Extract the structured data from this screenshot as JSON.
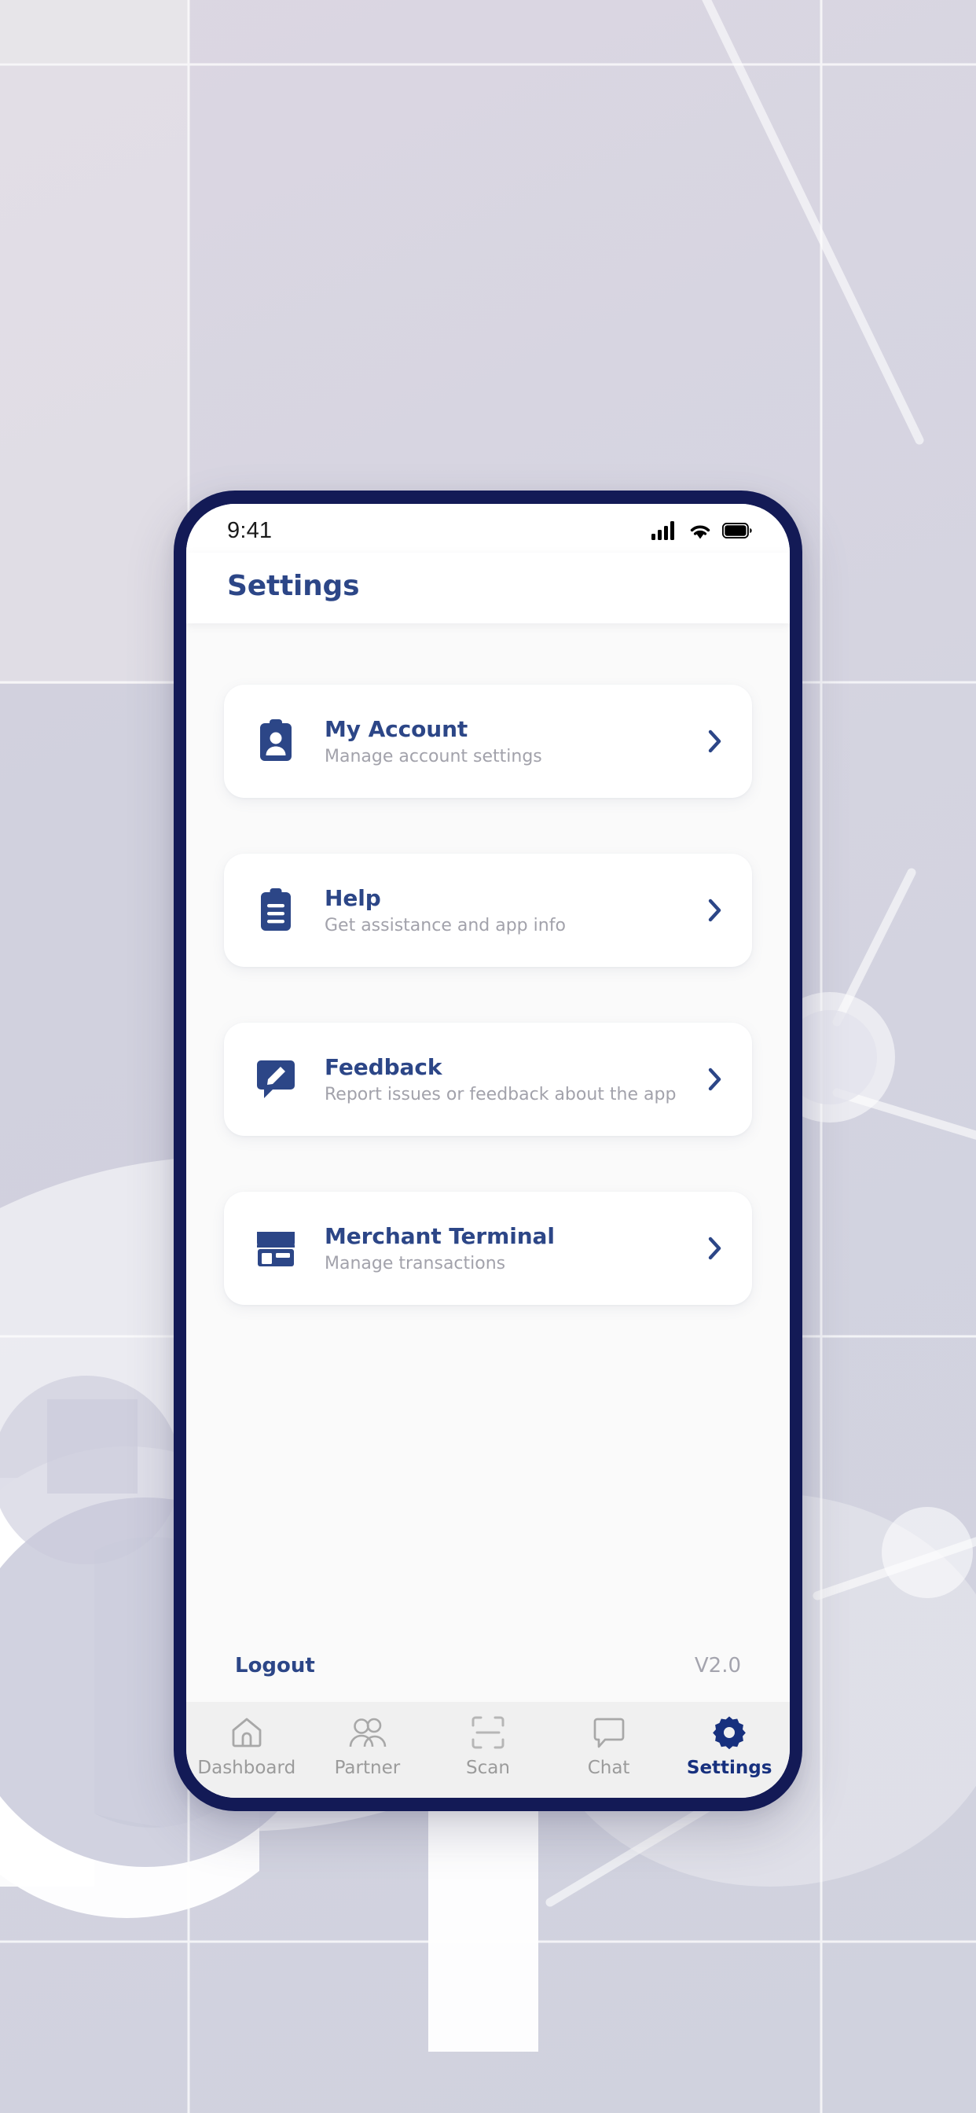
{
  "background": {
    "description": "abstract light lavender grid with network nodes and large white C monogram",
    "base_color": "#d6d4e0",
    "grid_line_color": "#ffffff",
    "accent_shape_color": "#ffffff"
  },
  "phone": {
    "bezel_color": "#131a56",
    "screen_bg": "#ffffff"
  },
  "statusbar": {
    "time": "9:41",
    "icons": [
      {
        "name": "cellular-signal-icon",
        "label": "Cellular signal"
      },
      {
        "name": "wifi-icon",
        "label": "Wi-Fi"
      },
      {
        "name": "battery-icon",
        "label": "Battery"
      }
    ]
  },
  "header": {
    "title": "Settings",
    "title_color": "#2c4687"
  },
  "menu": {
    "items": [
      {
        "icon": "id-badge-icon",
        "title": "My Account",
        "subtitle": "Manage account settings",
        "chevron": "chevron-right-icon"
      },
      {
        "icon": "clipboard-icon",
        "title": "Help",
        "subtitle": "Get assistance and app info",
        "chevron": "chevron-right-icon"
      },
      {
        "icon": "feedback-bubble-pencil-icon",
        "title": "Feedback",
        "subtitle": "Report issues or feedback about the app",
        "chevron": "chevron-right-icon"
      },
      {
        "icon": "storefront-icon",
        "title": "Merchant Terminal",
        "subtitle": "Manage transactions",
        "chevron": "chevron-right-icon"
      }
    ]
  },
  "footer": {
    "logout_label": "Logout",
    "version_label": "V2.0"
  },
  "bottomnav": {
    "active_color": "#17307e",
    "inactive_color": "#9b9b9b",
    "items": [
      {
        "icon": "home-icon",
        "label": "Dashboard",
        "active": false
      },
      {
        "icon": "people-icon",
        "label": "Partner",
        "active": false
      },
      {
        "icon": "scan-icon",
        "label": "Scan",
        "active": false
      },
      {
        "icon": "chat-icon",
        "label": "Chat",
        "active": false
      },
      {
        "icon": "gear-icon",
        "label": "Settings",
        "active": true
      }
    ]
  }
}
